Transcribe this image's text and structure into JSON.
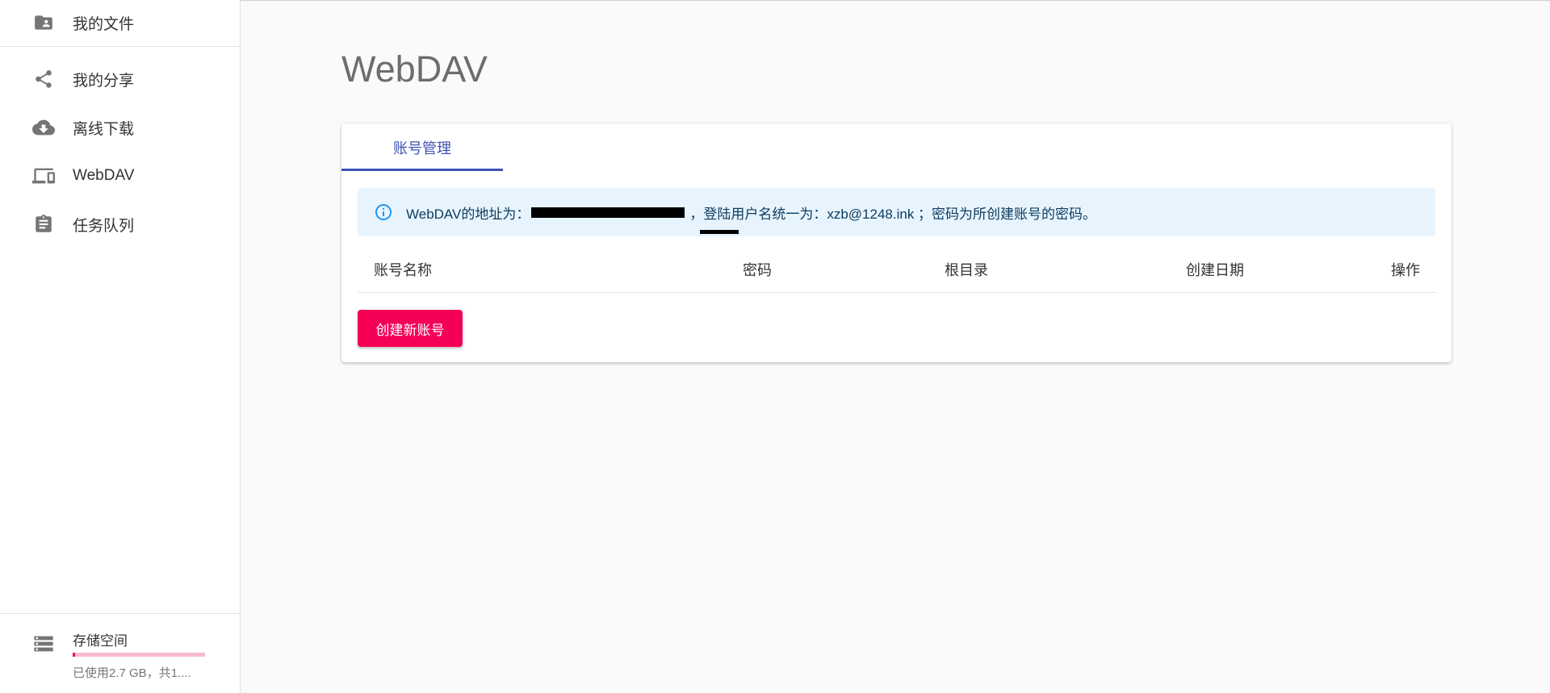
{
  "sidebar": {
    "top_item": {
      "label": "我的文件",
      "icon": "folder-shared-icon"
    },
    "items": [
      {
        "label": "我的分享",
        "icon": "share-icon"
      },
      {
        "label": "离线下载",
        "icon": "cloud-download-icon"
      },
      {
        "label": "WebDAV",
        "icon": "devices-icon"
      },
      {
        "label": "任务队列",
        "icon": "assignment-icon"
      }
    ],
    "storage": {
      "title": "存储空间",
      "usage": "已使用2.7 GB，共1....",
      "used_fraction": 0.02
    }
  },
  "main": {
    "title": "WebDAV",
    "tabs": [
      {
        "label": "账号管理"
      }
    ],
    "alert": {
      "prefix": "WebDAV的地址为：",
      "separator": "，",
      "login_word": "登陆",
      "suffix": "用户名统一为：xzb@1248.ink ；密码为所创建账号的密码。"
    },
    "table": {
      "columns": [
        "账号名称",
        "密码",
        "根目录",
        "创建日期",
        "操作"
      ]
    },
    "create_button": "创建新账号"
  },
  "colors": {
    "primary": "#3f51b5",
    "secondary": "#f50057",
    "alert_bg": "#e8f4fd",
    "alert_text": "#0d3c61",
    "icon_gray": "#757575"
  }
}
